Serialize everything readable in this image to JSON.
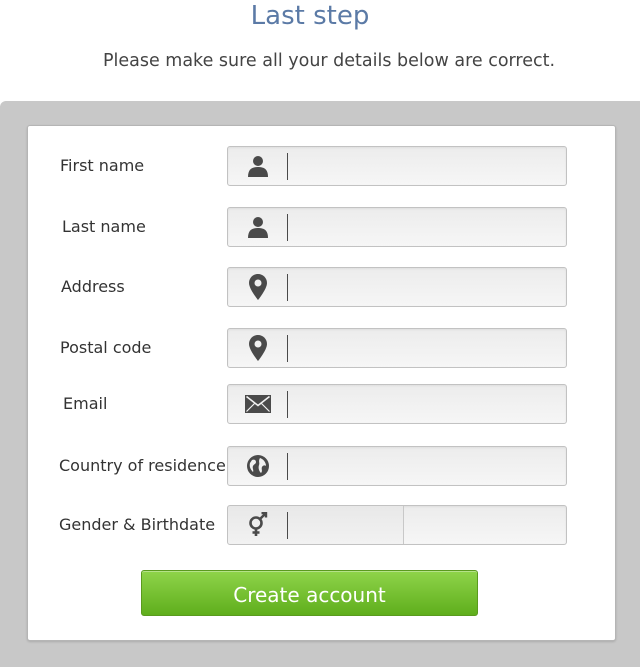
{
  "header": {
    "title": "Last step",
    "subtitle": "Please make sure all your details below are correct."
  },
  "form": {
    "fields": [
      {
        "label": "First name",
        "icon": "user-icon",
        "value": "",
        "placeholder": ""
      },
      {
        "label": "Last name",
        "icon": "user-icon",
        "value": "",
        "placeholder": ""
      },
      {
        "label": "Address",
        "icon": "location-pin-icon",
        "value": "",
        "placeholder": ""
      },
      {
        "label": "Postal code",
        "icon": "location-pin-icon",
        "value": "",
        "placeholder": ""
      },
      {
        "label": "Email",
        "icon": "envelope-icon",
        "value": "",
        "placeholder": ""
      },
      {
        "label": "Country of residence",
        "icon": "globe-icon",
        "value": "",
        "placeholder": ""
      },
      {
        "label": "Gender & Birthdate",
        "icon": "gender-icon",
        "gender_value": "",
        "birthdate_value": ""
      }
    ],
    "submit_label": "Create account"
  },
  "colors": {
    "title": "#5b7aa6",
    "button_top": "#8fd44a",
    "button_bottom": "#5fae1c",
    "icon": "#4a4a4a"
  }
}
